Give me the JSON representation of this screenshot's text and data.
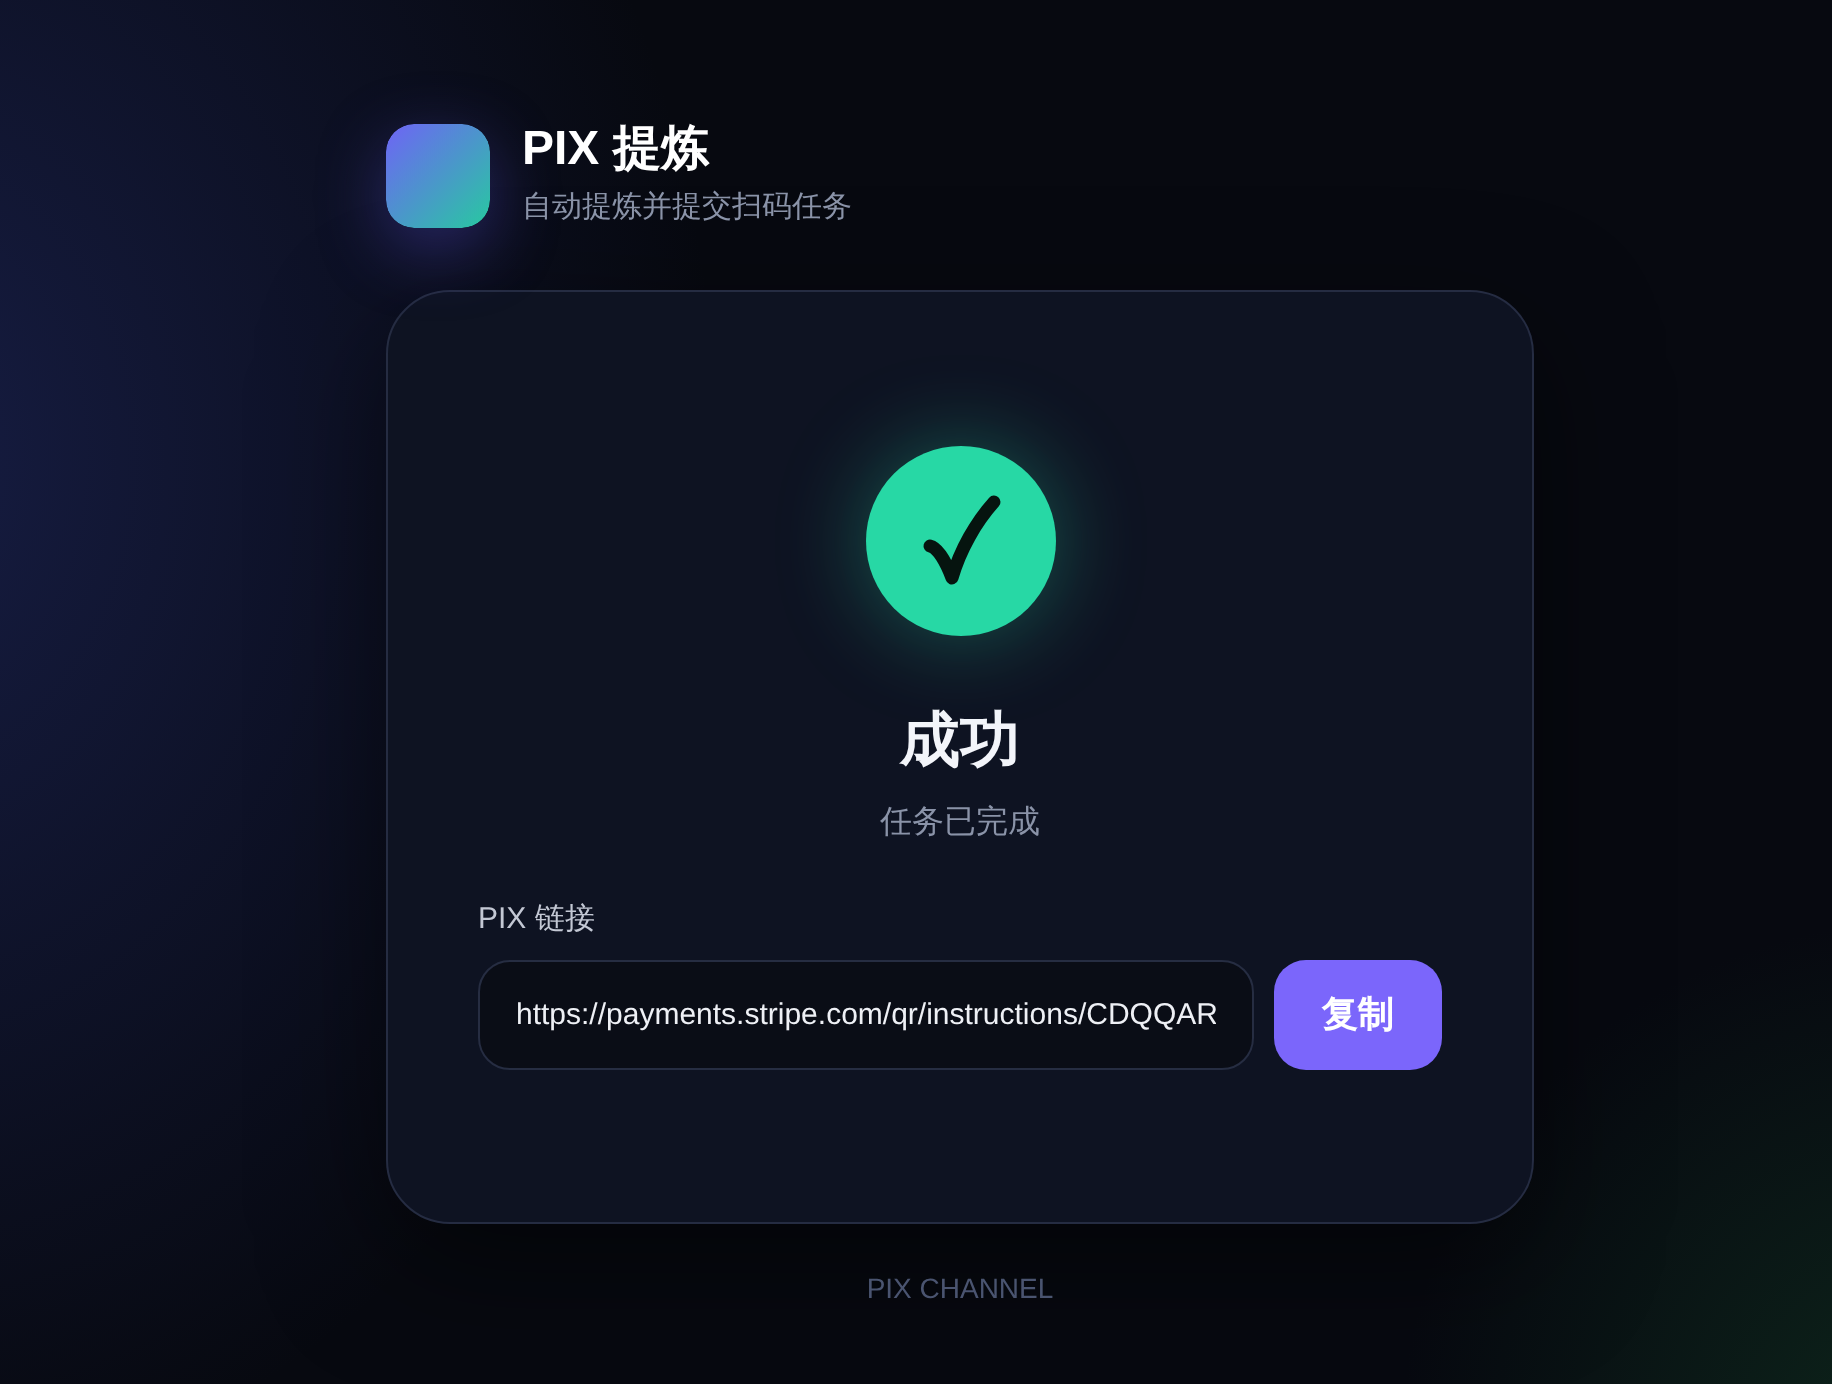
{
  "header": {
    "title": "PIX 提炼",
    "subtitle": "自动提炼并提交扫码任务"
  },
  "result": {
    "title": "成功",
    "message": "任务已完成"
  },
  "link": {
    "label": "PIX 链接",
    "value": "https://payments.stripe.com/qr/instructions/CDQQAR",
    "button": "复制"
  },
  "footer": "PIX CHANNEL"
}
